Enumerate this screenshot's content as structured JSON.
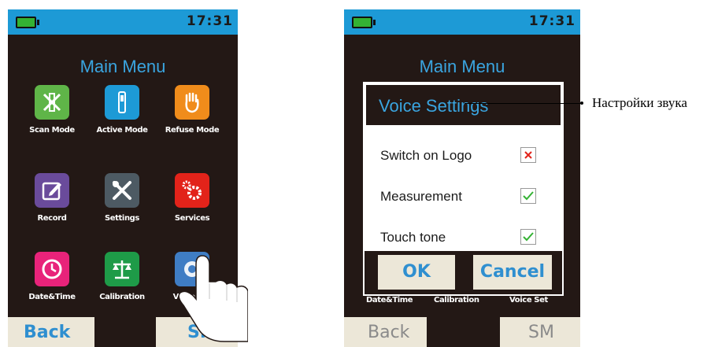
{
  "left_screen": {
    "status": {
      "time": "17:31"
    },
    "title": "Main Menu",
    "items": [
      {
        "label": "Scan Mode",
        "icon": "scan-mode-icon",
        "color": "#5fb548"
      },
      {
        "label": "Active Mode",
        "icon": "active-mode-icon",
        "color": "#1d9ad6"
      },
      {
        "label": "Refuse Mode",
        "icon": "refuse-mode-icon",
        "color": "#f08c1b"
      },
      {
        "label": "Record",
        "icon": "record-icon",
        "color": "#6a4b9b"
      },
      {
        "label": "Settings",
        "icon": "settings-icon",
        "color": "#4d5a63"
      },
      {
        "label": "Services",
        "icon": "services-icon",
        "color": "#e2231a"
      },
      {
        "label": "Date&Time",
        "icon": "clock-icon",
        "color": "#e8237a"
      },
      {
        "label": "Calibration",
        "icon": "balance-icon",
        "color": "#1e9b48"
      },
      {
        "label": "Voice Set",
        "icon": "voice-icon",
        "color": "#3f7dc4"
      }
    ],
    "back_label": "Back",
    "sm_label": "SM"
  },
  "right_screen": {
    "status": {
      "time": "17:31"
    },
    "title": "Main Menu",
    "dialog": {
      "title": "Voice Settings",
      "rows": [
        {
          "label": "Switch on Logo",
          "checked": false
        },
        {
          "label": "Measurement",
          "checked": true
        },
        {
          "label": "Touch tone",
          "checked": true
        }
      ],
      "ok_label": "OK",
      "cancel_label": "Cancel"
    },
    "behind_labels": [
      "Date&Time",
      "Calibration",
      "Voice Set"
    ],
    "back_label": "Back",
    "sm_label": "SM"
  },
  "annotation": "Настройки звука",
  "colors": {
    "status_bar": "#1d9ad6",
    "screen_bg": "#231815",
    "title": "#3aa5e0",
    "button_bg": "#ece7d8"
  }
}
